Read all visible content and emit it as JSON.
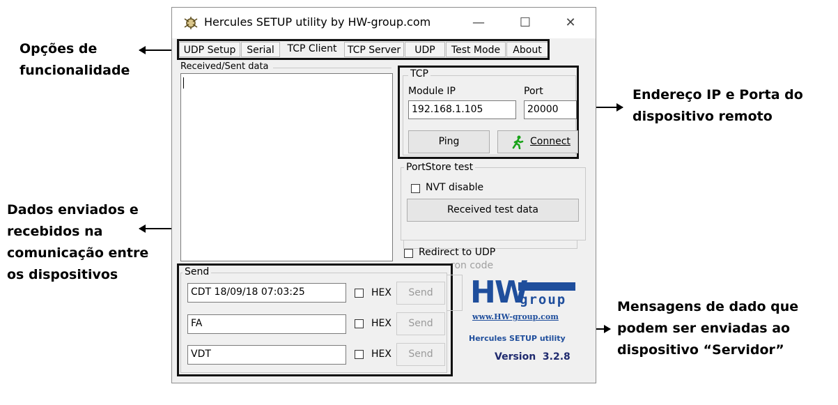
{
  "window": {
    "title": "Hercules SETUP utility by HW-group.com",
    "controls": {
      "minimize": "—",
      "maximize": "☐",
      "close": "✕"
    }
  },
  "tabs": [
    {
      "label": "UDP Setup",
      "active": false
    },
    {
      "label": "Serial",
      "active": false
    },
    {
      "label": "TCP Client",
      "active": true
    },
    {
      "label": "TCP Server",
      "active": false
    },
    {
      "label": "UDP",
      "active": false
    },
    {
      "label": "Test Mode",
      "active": false
    },
    {
      "label": "About",
      "active": false
    }
  ],
  "received_sent": {
    "label": "Received/Sent data",
    "content": ""
  },
  "tcp": {
    "group_label": "TCP",
    "module_ip_label": "Module IP",
    "module_ip_value": "192.168.1.105",
    "port_label": "Port",
    "port_value": "20000",
    "ping_label": "Ping",
    "connect_label": "Connect"
  },
  "portstore": {
    "group_label": "PortStore test",
    "nvt_label": "NVT disable",
    "received_test_label": "Received test data"
  },
  "redirect": {
    "label": "Redirect to UDP",
    "partial_label": "ron code"
  },
  "send": {
    "group_label": "Send",
    "rows": [
      {
        "value": "CDT 18/09/18 07:03:25",
        "hex_label": "HEX",
        "send_label": "Send"
      },
      {
        "value": "FA",
        "hex_label": "HEX",
        "send_label": "Send"
      },
      {
        "value": "VDT",
        "hex_label": "HEX",
        "send_label": "Send"
      }
    ]
  },
  "about_logo": {
    "hw_text": "HW",
    "group_text": "group",
    "url": "www.HW-group.com",
    "product": "Hercules SETUP utility",
    "version_label": "Version  3.2.8",
    "brand_color": "#1f4e9c"
  },
  "annotations": {
    "options": [
      "Opções de",
      "funcionalidade"
    ],
    "data": [
      "Dados enviados e",
      "recebidos na",
      "comunicação entre",
      "os dispositivos"
    ],
    "ip_port": [
      "Endereço IP e Porta do",
      "dispositivo remoto"
    ],
    "messages": [
      "Mensagens de dado que",
      "podem ser enviadas ao",
      "dispositivo “Servidor”"
    ]
  }
}
